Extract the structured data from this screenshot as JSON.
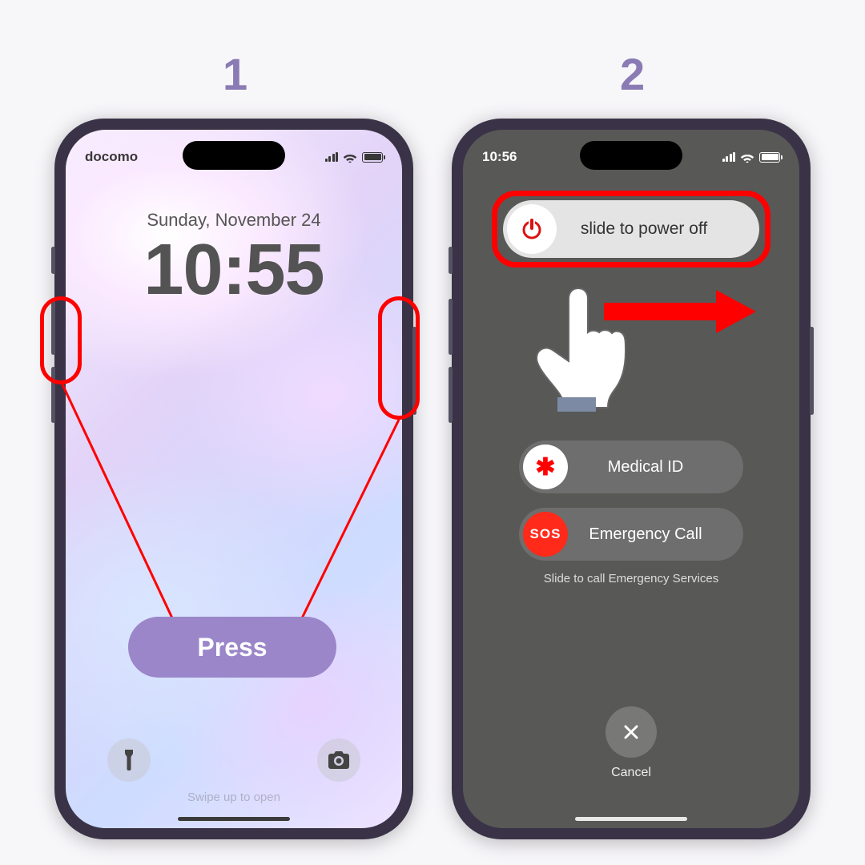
{
  "steps": {
    "one": "1",
    "two": "2"
  },
  "phone1": {
    "carrier": "docomo",
    "date": "Sunday, November 24",
    "time": "10:55",
    "swipe_hint": "Swipe up to open",
    "press_label": "Press"
  },
  "phone2": {
    "time": "10:56",
    "power_slider": "slide to power off",
    "medical_slider": "Medical ID",
    "sos_slider": "Emergency Call",
    "sos_knob": "SOS",
    "medical_knob": "✱",
    "sos_hint": "Slide to call Emergency Services",
    "cancel": "Cancel"
  }
}
